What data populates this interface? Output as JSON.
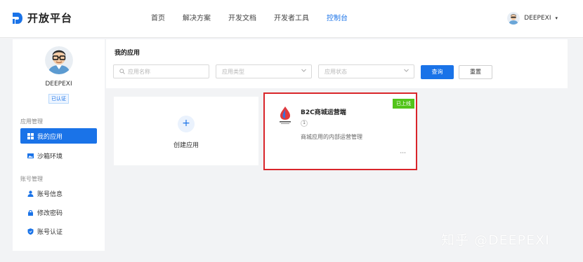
{
  "brand": {
    "name": "开放平台",
    "color": "#1a73e8"
  },
  "nav": {
    "items": [
      {
        "label": "首页"
      },
      {
        "label": "解决方案"
      },
      {
        "label": "开发文档"
      },
      {
        "label": "开发者工具"
      },
      {
        "label": "控制台",
        "active": true
      }
    ]
  },
  "user": {
    "name": "DEEPEXI",
    "caret": "▾",
    "verified": "已认证"
  },
  "sidebar": {
    "group1": "应用管理",
    "group2": "账号管理",
    "items": [
      {
        "label": "我的应用",
        "icon": "grid-icon",
        "active": true
      },
      {
        "label": "沙箱环境",
        "icon": "image-icon"
      },
      {
        "label": "账号信息",
        "icon": "user-icon"
      },
      {
        "label": "修改密码",
        "icon": "lock-icon"
      },
      {
        "label": "账号认证",
        "icon": "shield-icon"
      }
    ]
  },
  "filter": {
    "title": "我的应用",
    "name_placeholder": "应用名称",
    "type_placeholder": "应用类型",
    "status_placeholder": "应用状态",
    "query_label": "查询",
    "reset_label": "重置"
  },
  "create_card": {
    "plus": "+",
    "label": "创建应用"
  },
  "app_card": {
    "title": "B2C商城运营端",
    "badge": "已上线",
    "badge_color": "#52c41a",
    "number": "1",
    "description": "商城应用的内部运营管理",
    "more": "···",
    "highlight_color": "#d9252a"
  },
  "watermark": "知乎 @DEEPEXI"
}
